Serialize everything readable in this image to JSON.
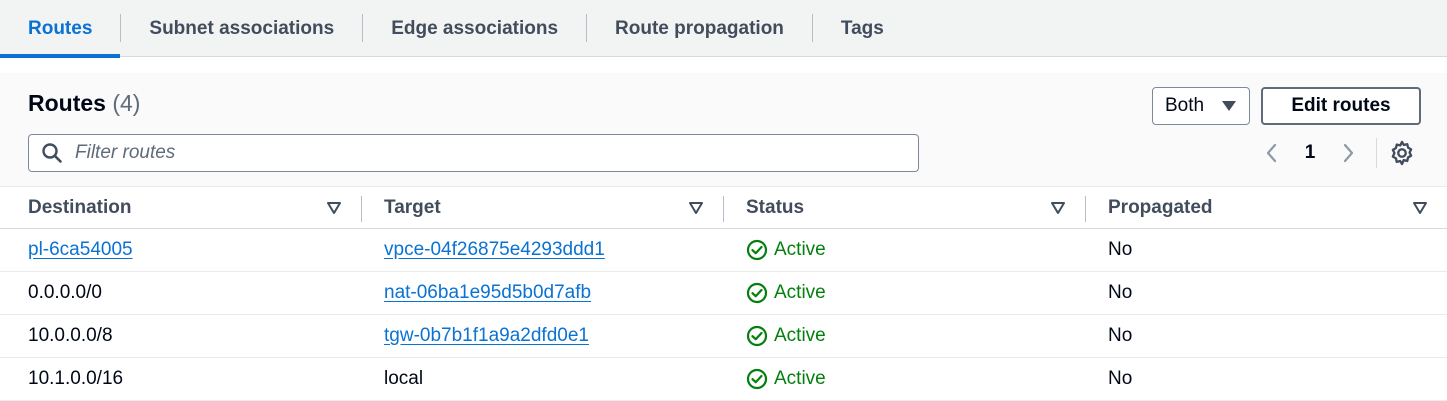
{
  "tabs": [
    {
      "label": "Routes",
      "active": true
    },
    {
      "label": "Subnet associations",
      "active": false
    },
    {
      "label": "Edge associations",
      "active": false
    },
    {
      "label": "Route propagation",
      "active": false
    },
    {
      "label": "Tags",
      "active": false
    }
  ],
  "header": {
    "title": "Routes",
    "count": "(4)",
    "filter_placeholder": "Filter routes",
    "select_value": "Both",
    "edit_button": "Edit routes",
    "page_number": "1"
  },
  "columns": [
    "Destination",
    "Target",
    "Status",
    "Propagated"
  ],
  "rows": [
    {
      "destination": "pl-6ca54005",
      "destination_link": true,
      "target": "vpce-04f26875e4293ddd1",
      "target_link": true,
      "status": "Active",
      "propagated": "No"
    },
    {
      "destination": "0.0.0.0/0",
      "destination_link": false,
      "target": "nat-06ba1e95d5b0d7afb",
      "target_link": true,
      "status": "Active",
      "propagated": "No"
    },
    {
      "destination": "10.0.0.0/8",
      "destination_link": false,
      "target": "tgw-0b7b1f1a9a2dfd0e1",
      "target_link": true,
      "status": "Active",
      "propagated": "No"
    },
    {
      "destination": "10.1.0.0/16",
      "destination_link": false,
      "target": "local",
      "target_link": false,
      "status": "Active",
      "propagated": "No"
    }
  ],
  "colors": {
    "accent": "#0972d3",
    "success": "#037f0c",
    "text": "#000716",
    "muted": "#5f6b7a"
  },
  "icons": {
    "search": "search-icon",
    "dropdown": "caret-down-icon",
    "prev": "chevron-left-icon",
    "next": "chevron-right-icon",
    "settings": "gear-icon",
    "sort": "sort-triangle-icon",
    "status": "check-circle-icon"
  }
}
